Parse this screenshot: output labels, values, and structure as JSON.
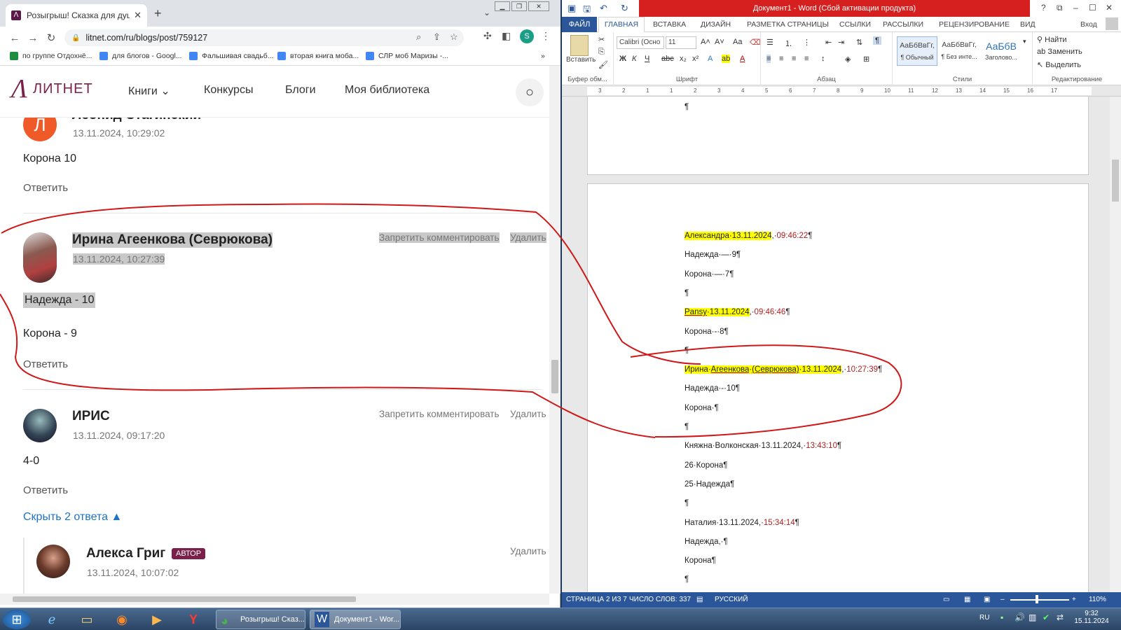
{
  "browser": {
    "tab_title": "Розыгрыш! Сказка для души - Б",
    "url": "litnet.com/ru/blogs/post/759127",
    "profile_initial": "S",
    "bookmarks": [
      "по группе Отдохнё...",
      "для блогов - Googl...",
      "Фальшивая свадьб...",
      "вторая книга моба...",
      "СЛР моб Маризы -..."
    ],
    "bookmarks_more": "»"
  },
  "site": {
    "logo_mark": "Λ",
    "logo_text": "ЛИТНЕТ",
    "nav": [
      "Книги ⌄",
      "Конкурсы",
      "Блоги",
      "Моя библиотека"
    ],
    "search_icon": "search-icon"
  },
  "comments": [
    {
      "author": "Леонид Стагинский",
      "date": "13.11.2024, 10:29:02",
      "text": [
        "Корона 10"
      ],
      "reply": "Ответить",
      "avatar_letter": "Л",
      "avatar_color": "#f05a28"
    },
    {
      "author": "Ирина Агеенкова (Севрюкова)",
      "date": "13.11.2024, 10:27:39",
      "text": [
        "Надежда - 10",
        "Корона - 9"
      ],
      "reply": "Ответить",
      "actions": [
        "Запретить комментировать",
        "Удалить"
      ]
    },
    {
      "author": "ИРИС",
      "date": "13.11.2024, 09:17:20",
      "text": [
        "4-0"
      ],
      "reply": "Ответить",
      "actions": [
        "Запретить комментировать",
        "Удалить"
      ],
      "toggle": "Скрыть 2 ответа"
    },
    {
      "author": "Алекса Григ",
      "badge": "АВТОР",
      "date": "13.11.2024, 10:07:02",
      "actions": [
        "Удалить"
      ]
    }
  ],
  "word": {
    "title": "Документ1 - Word (Сбой активации продукта)",
    "signin": "Вход",
    "tabs": [
      "ФАЙЛ",
      "ГЛАВНАЯ",
      "ВСТАВКА",
      "ДИЗАЙН",
      "РАЗМЕТКА СТРАНИЦЫ",
      "ССЫЛКИ",
      "РАССЫЛКИ",
      "РЕЦЕНЗИРОВАНИЕ",
      "ВИД"
    ],
    "font_name": "Calibri (Осно",
    "font_size": "11",
    "paste_label": "Вставить",
    "groups": [
      "Буфер обм...",
      "Шрифт",
      "Абзац",
      "Стили",
      "Редактирование"
    ],
    "styles": [
      {
        "sample": "АаБбВвГг,",
        "name": "¶ Обычный"
      },
      {
        "sample": "АаБбВвГг,",
        "name": "¶ Без инте..."
      },
      {
        "sample": "АаБбВ",
        "name": "Заголово..."
      }
    ],
    "edit": [
      "Найти",
      "Заменить",
      "Выделить"
    ],
    "ruler_numbers": [
      "3",
      "2",
      "1",
      "1",
      "2",
      "3",
      "4",
      "5",
      "6",
      "7",
      "8",
      "9",
      "10",
      "11",
      "12",
      "13",
      "14",
      "15",
      "16",
      "17"
    ],
    "doc_lines": [
      {
        "parts": [
          {
            "t": "Александра·13.11.2024",
            "hl": true
          },
          {
            "t": ",·"
          },
          {
            "t": "09:46:22",
            "tm": true
          },
          {
            "t": "¶"
          }
        ]
      },
      {
        "parts": [
          {
            "t": "Надежда·—·9¶"
          }
        ]
      },
      {
        "parts": [
          {
            "t": "Корона·—·7¶"
          }
        ]
      },
      {
        "parts": [
          {
            "t": "¶"
          }
        ]
      },
      {
        "parts": [
          {
            "t": "Pansy",
            "hl": true,
            "ul": true
          },
          {
            "t": "·13.11.2024",
            "hl": true
          },
          {
            "t": ",·"
          },
          {
            "t": "09:46:46",
            "tm": true
          },
          {
            "t": "¶"
          }
        ]
      },
      {
        "parts": [
          {
            "t": "Корона·-·8¶"
          }
        ]
      },
      {
        "parts": [
          {
            "t": "¶"
          }
        ]
      },
      {
        "parts": [
          {
            "t": "Ирина·",
            "hl": true
          },
          {
            "t": "Агеенкова",
            "hl": true,
            "ul": true
          },
          {
            "t": "·",
            "hl": true
          },
          {
            "t": "(Севрюкова)",
            "hl": true,
            "ul": true
          },
          {
            "t": "·13.11.2024",
            "hl": true
          },
          {
            "t": ",·"
          },
          {
            "t": "10:27:39",
            "tm": true
          },
          {
            "t": "¶"
          }
        ]
      },
      {
        "parts": [
          {
            "t": "Надежда·-·10¶"
          }
        ]
      },
      {
        "parts": [
          {
            "t": "Корона·¶"
          }
        ]
      },
      {
        "parts": [
          {
            "t": "¶"
          }
        ]
      },
      {
        "parts": [
          {
            "t": "Княжна·Волконская·13.11.2024,·"
          },
          {
            "t": "13:43:10",
            "tm": true
          },
          {
            "t": "¶"
          }
        ]
      },
      {
        "parts": [
          {
            "t": "26·Корона¶"
          }
        ]
      },
      {
        "parts": [
          {
            "t": "25·Надежда¶"
          }
        ]
      },
      {
        "parts": [
          {
            "t": "¶"
          }
        ]
      },
      {
        "parts": [
          {
            "t": "Наталия·13.11.2024,·"
          },
          {
            "t": "15:34:14",
            "tm": true
          },
          {
            "t": "¶"
          }
        ]
      },
      {
        "parts": [
          {
            "t": "Надежда,·¶"
          }
        ]
      },
      {
        "parts": [
          {
            "t": "Корона¶"
          }
        ]
      },
      {
        "parts": [
          {
            "t": "¶"
          }
        ]
      }
    ],
    "top_page_mark": "¶",
    "status": {
      "page": "СТРАНИЦА 2 ИЗ 7",
      "words": "ЧИСЛО СЛОВ: 337",
      "lang": "РУССКИЙ",
      "zoom": "110%"
    }
  },
  "taskbar": {
    "tasks": [
      "Розыгрыш! Сказ...",
      "Документ1 - Wor..."
    ],
    "lang": "RU",
    "time": "9:32",
    "date": "15.11.2024"
  },
  "colors": {
    "accent_red": "#d62020",
    "word_blue": "#2b579a",
    "litnet_brand": "#7b1f4b",
    "annotation": "#d01818"
  }
}
